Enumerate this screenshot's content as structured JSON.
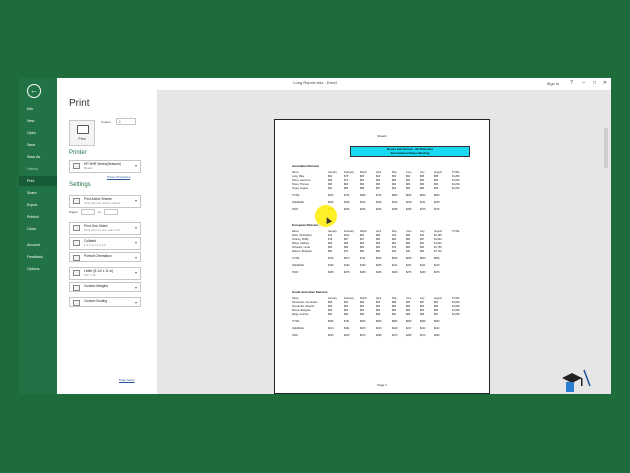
{
  "window": {
    "title": "Long Report.xlsx - Excel",
    "sign_in": "Sign in"
  },
  "window_controls": {
    "help": "?",
    "minimize": "–",
    "restore": "□",
    "close": "✕"
  },
  "nav": {
    "back_icon": "back-arrow-icon",
    "items": [
      {
        "label": "Info"
      },
      {
        "label": "New"
      },
      {
        "label": "Open"
      },
      {
        "label": "Save"
      },
      {
        "label": "Save As"
      },
      {
        "label": "History"
      },
      {
        "label": "Print",
        "active": true
      },
      {
        "label": "Share"
      },
      {
        "label": "Export"
      },
      {
        "label": "Publish"
      },
      {
        "label": "Close"
      },
      {
        "label": "Account"
      },
      {
        "label": "Feedback"
      },
      {
        "label": "Options"
      }
    ]
  },
  "print": {
    "heading": "Print",
    "print_button_label": "Print",
    "copies_label": "Copies:",
    "copies_value": "1",
    "printer_heading": "Printer",
    "printer_name": "HP-9HR Series(Network)",
    "printer_status": "Ready",
    "printer_properties_link": "Printer Properties",
    "settings_heading": "Settings",
    "pages_label": "Pages:",
    "pages_to_label": "to",
    "settings": [
      {
        "title": "Print Active Sheets",
        "desc": "Only print the active sheets"
      },
      {
        "title": "Print One Sided",
        "desc": "Only print on one side of th..."
      },
      {
        "title": "Collated",
        "desc": "1,2,3   1,2,3   1,2,3"
      },
      {
        "title": "Portrait Orientation",
        "desc": ""
      },
      {
        "title": "Letter (8 1/2 x 11 in)",
        "desc": "8.5\" x 11\""
      },
      {
        "title": "Custom Margins",
        "desc": ""
      },
      {
        "title": "Custom Scaling",
        "desc": ""
      }
    ],
    "page_setup_link": "Page Setup"
  },
  "preview": {
    "sheet_name": "Sheet1",
    "title_line1": "Books and Sound - All Divisions",
    "title_line2": "International Sales Meeting",
    "page_label": "Page 1",
    "divisions": [
      {
        "name": "Australian Division",
        "header": [
          "Name",
          "January",
          "February",
          "March",
          "April",
          "May",
          "June",
          "July",
          "August",
          "TOTAL"
        ],
        "rows": [
          [
            "Long, Mike",
            "$90",
            "$78",
            "$65",
            "$44",
            "$56",
            "$54",
            "$65",
            "$58",
            "$1,890"
          ],
          [
            "Oliver, Lawrence",
            "$80",
            "$72",
            "$84",
            "$89",
            "$88",
            "$84",
            "$80",
            "$92",
            "$1,800"
          ],
          [
            "Sham, Thomas",
            "$80",
            "$82",
            "$90",
            "$86",
            "$82",
            "$86",
            "$86",
            "$84",
            "$1,800"
          ],
          [
            "Unger, Angela",
            "$90",
            "$85",
            "$88",
            "$87",
            "$82",
            "$80",
            "$89",
            "$86",
            "$1,800"
          ]
        ],
        "total": [
          "TOTAL",
          "$430",
          "$750",
          "$680",
          "$740",
          "$860",
          "$816",
          "$810",
          "$820",
          ""
        ],
        "average": [
          "AVERAGE",
          "$208",
          "$196",
          "$220",
          "$236",
          "$219",
          "$218",
          "$211",
          "$205",
          ""
        ],
        "high": [
          "HIGH",
          "$275",
          "$290",
          "$290",
          "$290",
          "$265",
          "$265",
          "$275",
          "$275",
          ""
        ]
      },
      {
        "name": "European Division",
        "header": [
          "Name",
          "January",
          "February",
          "March",
          "April",
          "May",
          "June",
          "July",
          "August",
          "TOTAL"
        ],
        "rows": [
          [
            "Abell, Christopher",
            "$10",
            "$112",
            "$82",
            "$80",
            "$14",
            "$90",
            "$10",
            "$2,185",
            ""
          ],
          [
            "Chaney, Phillip",
            "$78",
            "$87",
            "$97",
            "$80",
            "$84",
            "$80",
            "$87",
            "$1,824",
            ""
          ],
          [
            "Ricker, Mathew",
            "$80",
            "$85",
            "$80",
            "$85",
            "$82",
            "$80",
            "$91",
            "$1,800",
            ""
          ],
          [
            "Schwartz, Linda",
            "$95",
            "$98",
            "$80",
            "$96",
            "$78",
            "$83",
            "$80",
            "$1,765",
            ""
          ],
          [
            "Watson, Bridgette",
            "$60",
            "$70",
            "$80",
            "$50",
            "$40",
            "$30",
            "$84",
            "$1,700",
            ""
          ]
        ],
        "total": [
          "TOTAL",
          "$794",
          "$872",
          "$741",
          "$840",
          "$820",
          "$645",
          "$840",
          "$846",
          ""
        ],
        "average": [
          "AVERAGE",
          "$199",
          "$194",
          "$193",
          "$205",
          "$211",
          "$201",
          "$211",
          "$219",
          ""
        ],
        "high": [
          "HIGH",
          "$265",
          "$275",
          "$289",
          "$265",
          "$290",
          "$275",
          "$290",
          "$276",
          ""
        ]
      },
      {
        "name": "South American Division",
        "header": [
          "Name",
          "January",
          "February",
          "March",
          "April",
          "May",
          "June",
          "July",
          "August",
          "TOTAL"
        ],
        "rows": [
          [
            "Hernandez, Fernandez",
            "$98",
            "$94",
            "$90",
            "$92",
            "$88",
            "$95",
            "$87",
            "$84",
            "$1,890"
          ],
          [
            "Hernandez, Ricardo",
            "$90",
            "$60",
            "$82",
            "$90",
            "$85",
            "$89",
            "$84",
            "$80",
            "$1,895"
          ],
          [
            "Rivera, Bridgette",
            "$80",
            "$82",
            "$89",
            "$89",
            "$80",
            "$84",
            "$82",
            "$85",
            "$1,890"
          ],
          [
            "Diego, Antonio",
            "$90",
            "$89",
            "$85",
            "$88",
            "$82",
            "$88",
            "$89",
            "$81",
            "$1,895"
          ]
        ],
        "total": [
          "TOTAL",
          "$936",
          "$761",
          "$840",
          "$850",
          "$882",
          "$840",
          "$848",
          "$840",
          ""
        ],
        "average": [
          "AVERAGE",
          "$214",
          "$161",
          "$215",
          "$230",
          "$220",
          "$217",
          "$221",
          "$212",
          ""
        ],
        "high": [
          "HIGH",
          "$250",
          "$233",
          "$270",
          "$289",
          "$270",
          "$269",
          "$270",
          "$265",
          ""
        ]
      }
    ]
  }
}
